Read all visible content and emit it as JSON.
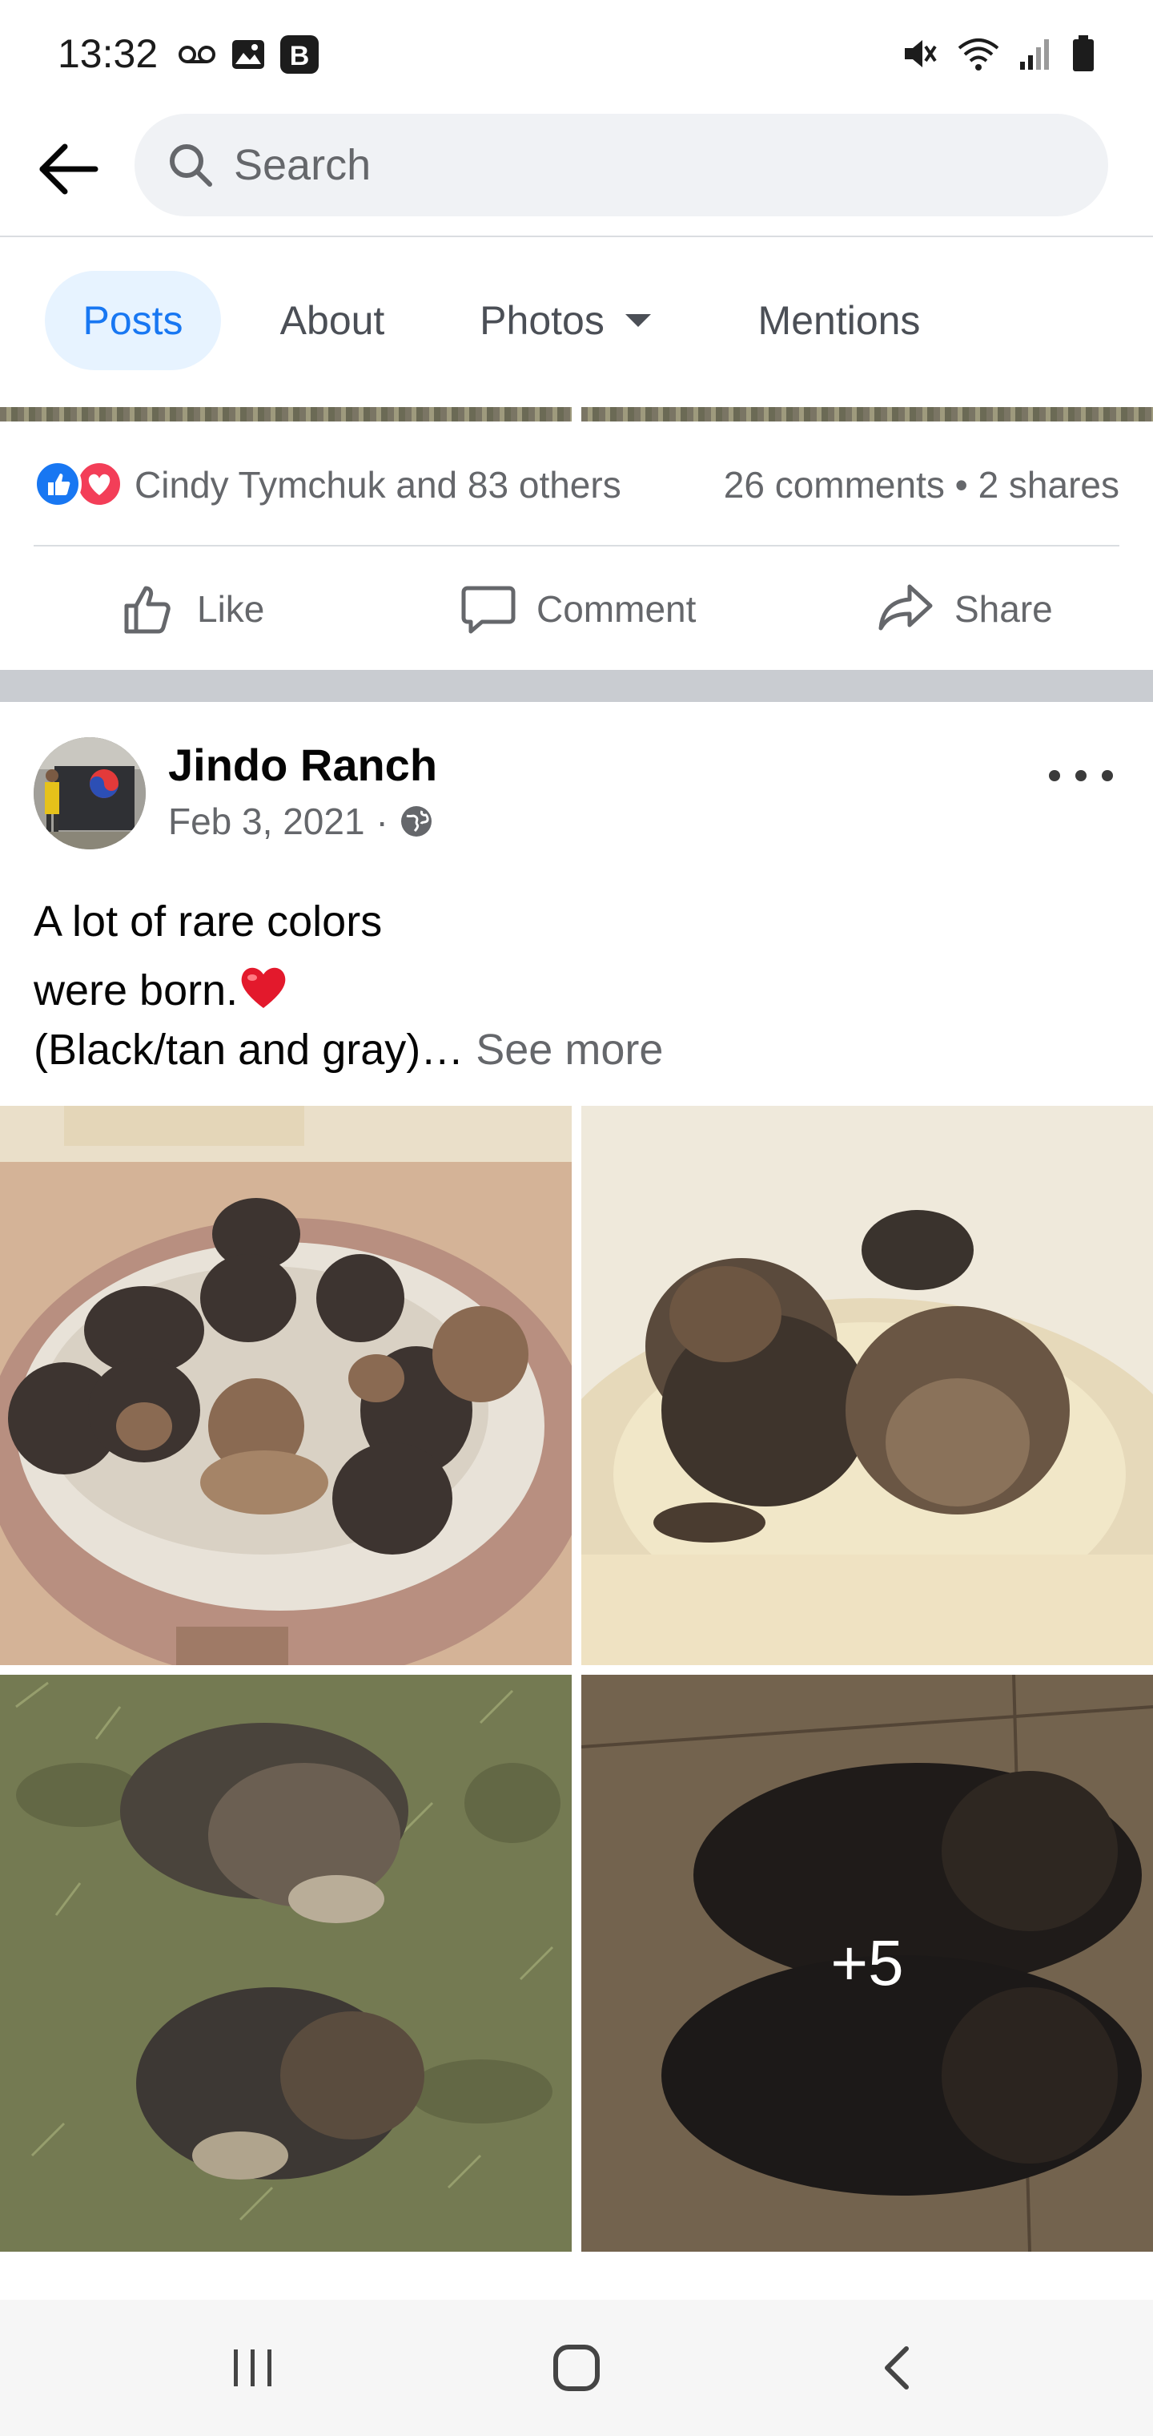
{
  "status_bar": {
    "time": "13:32",
    "left_icons": [
      "voicemail-icon",
      "image-icon",
      "b-app-icon"
    ],
    "right_icons": [
      "mute-icon",
      "wifi-icon",
      "signal-icon",
      "battery-icon"
    ]
  },
  "header": {
    "search_placeholder": "Search"
  },
  "tabs": [
    {
      "label": "Posts",
      "active": true
    },
    {
      "label": "About",
      "active": false
    },
    {
      "label": "Photos",
      "active": false,
      "has_dropdown": true
    },
    {
      "label": "Mentions",
      "active": false
    }
  ],
  "prev_post": {
    "reactions_text": "Cindy Tymchuk and 83 others",
    "comments": "26 comments",
    "separator": "•",
    "shares": "2 shares",
    "actions": {
      "like": "Like",
      "comment": "Comment",
      "share": "Share"
    }
  },
  "post": {
    "author": "Jindo Ranch",
    "date": "Feb 3, 2021",
    "dot": "·",
    "privacy_icon": "globe-icon",
    "text_line1": "A lot of rare colors",
    "text_line2": "were born.",
    "text_line3": "(Black/tan and gray)…",
    "see_more": "See more",
    "more_photos": "+5"
  },
  "colors": {
    "accent": "#1877f2",
    "love": "#f33e58",
    "muted_text": "#65676b",
    "tab_active_bg": "#e7f3ff"
  },
  "navigation": {
    "icons": [
      "recent-apps-icon",
      "home-icon",
      "back-nav-icon"
    ]
  }
}
